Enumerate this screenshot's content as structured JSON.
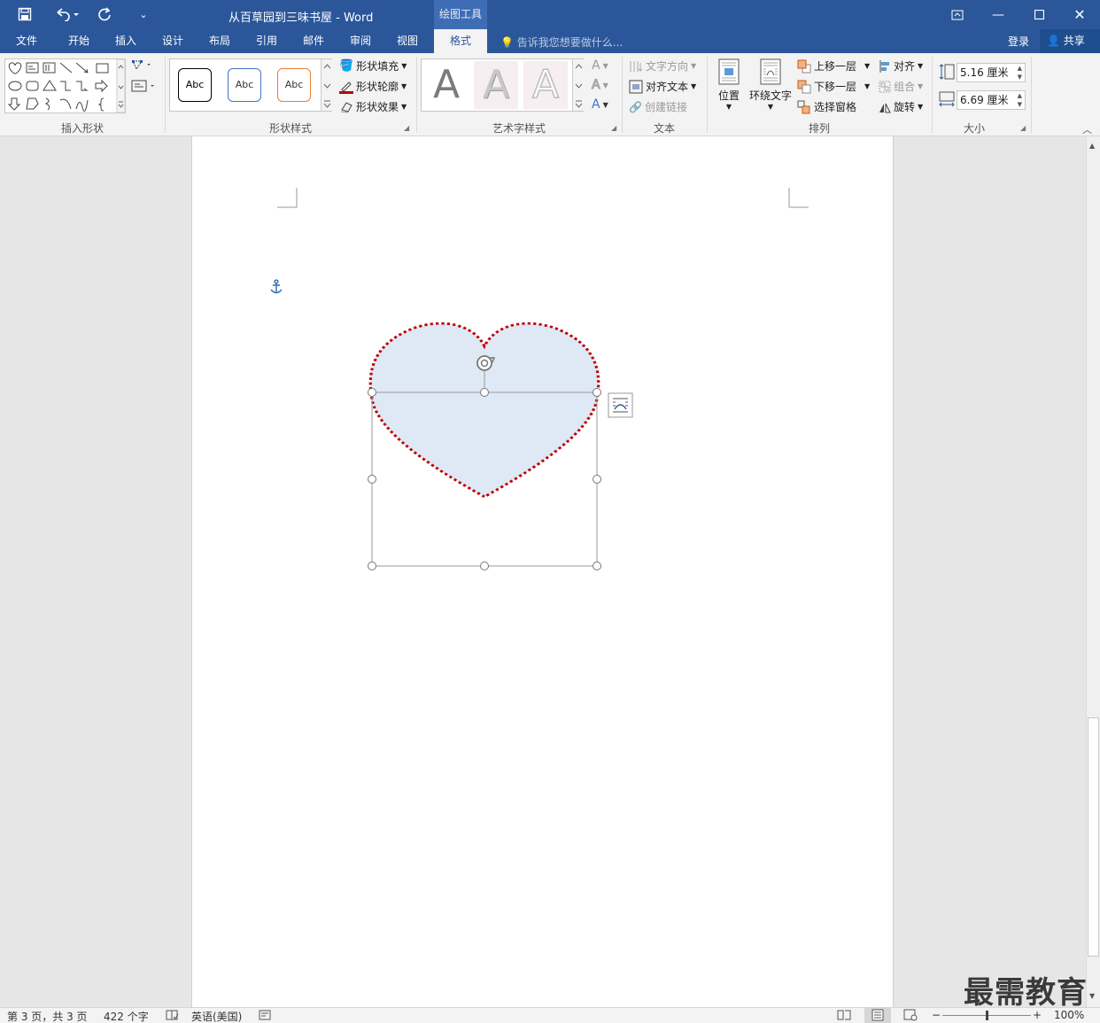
{
  "titlebar": {
    "doc_title": "从百草园到三味书屋 - Word",
    "context_tools": "绘图工具",
    "qa_save": "save-icon",
    "qa_undo": "undo-icon",
    "qa_redo": "redo-icon"
  },
  "tabs": [
    "文件",
    "开始",
    "插入",
    "设计",
    "布局",
    "引用",
    "邮件",
    "审阅",
    "视图",
    "格式"
  ],
  "active_tab": "格式",
  "tellme": "告诉我您想要做什么...",
  "login": "登录",
  "share": "共享",
  "ribbon": {
    "groups": {
      "insert_shapes": "插入形状",
      "shape_styles": "形状样式",
      "wordart_styles": "艺术字样式",
      "text": "文本",
      "arrange": "排列",
      "size": "大小"
    },
    "abc": [
      "Abc",
      "Abc",
      "Abc"
    ],
    "shape_fill": "形状填充",
    "shape_outline": "形状轮廓",
    "shape_effects": "形状效果",
    "wordart_letter": "A",
    "text_direction": "文字方向",
    "align_text": "对齐文本",
    "create_link": "创建链接",
    "position": "位置",
    "wrap_text": "环绕文字",
    "bring_forward": "上移一层",
    "send_backward": "下移一层",
    "selection_pane": "选择窗格",
    "align": "对齐",
    "group": "组合",
    "rotate": "旋转",
    "height": "5.16 厘米",
    "width": "6.69 厘米"
  },
  "colors": {
    "titlebar": "#2b579a",
    "heart_fill": "#dfe8f5",
    "heart_outline": "#c00000"
  },
  "status": {
    "page": "第 3 页，共 3 页",
    "words": "422 个字",
    "language": "英语(美国)",
    "zoom": "100%",
    "zoom_percent": 100
  },
  "watermark": "最需教育"
}
